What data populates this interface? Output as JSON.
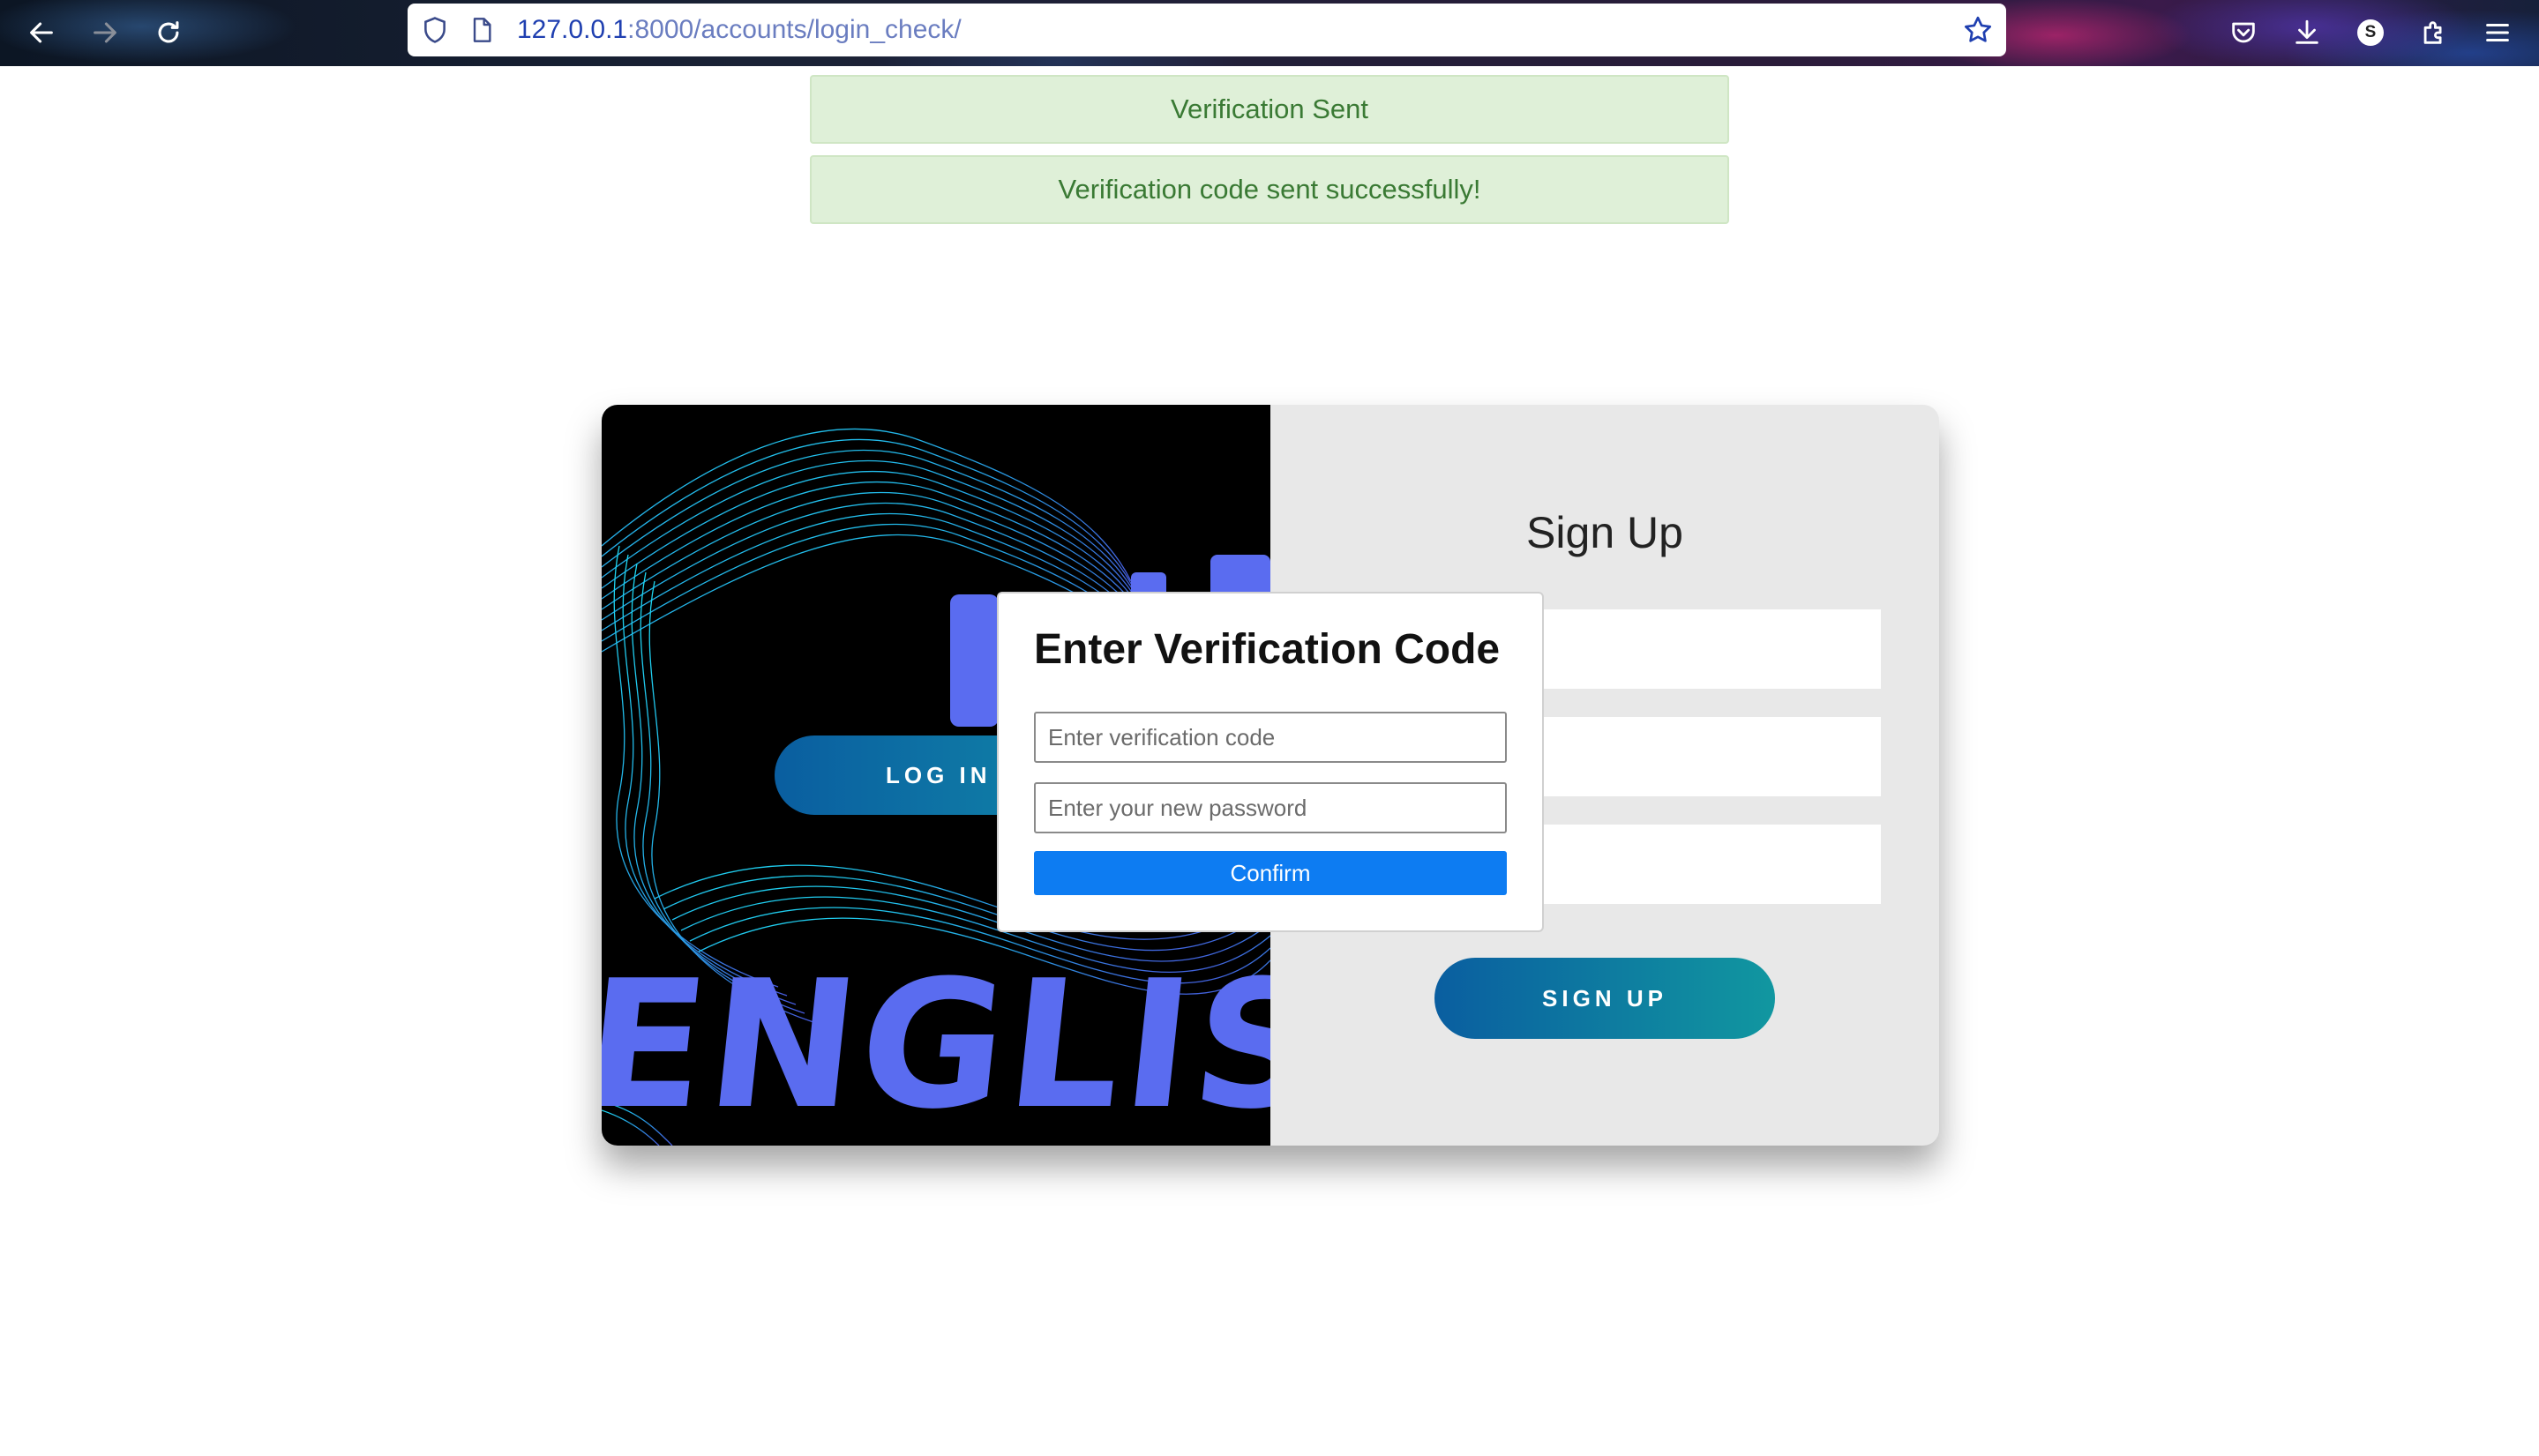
{
  "browser": {
    "url_host": "127.0.0.1",
    "url_path": ":8000/accounts/login_check/",
    "profile_initial": "S",
    "icons": [
      "back-arrow-icon",
      "forward-arrow-icon",
      "reload-icon",
      "shield-icon",
      "page-icon",
      "bookmark-star-icon",
      "pocket-icon",
      "download-icon",
      "extensions-icon",
      "menu-icon"
    ]
  },
  "alerts": [
    {
      "text": "Verification Sent"
    },
    {
      "text": "Verification code sent successfully!"
    }
  ],
  "card": {
    "left_panel": {
      "artwork_text": "ENGLIS",
      "login_label": "LOG IN"
    },
    "right_panel": {
      "title": "Sign Up",
      "signup_label": "SIGN UP"
    }
  },
  "modal": {
    "title": "Enter Verification Code",
    "code_placeholder": "Enter verification code",
    "password_placeholder": "Enter your new password",
    "confirm_label": "Confirm"
  },
  "colors": {
    "alert_bg": "#dff0d8",
    "alert_text": "#3a7a34",
    "confirm_blue": "#0d7cf2",
    "button_gradient_start": "#0a5ea0",
    "button_gradient_end": "#1197a0",
    "art_text_blue": "#5a6cf0"
  }
}
